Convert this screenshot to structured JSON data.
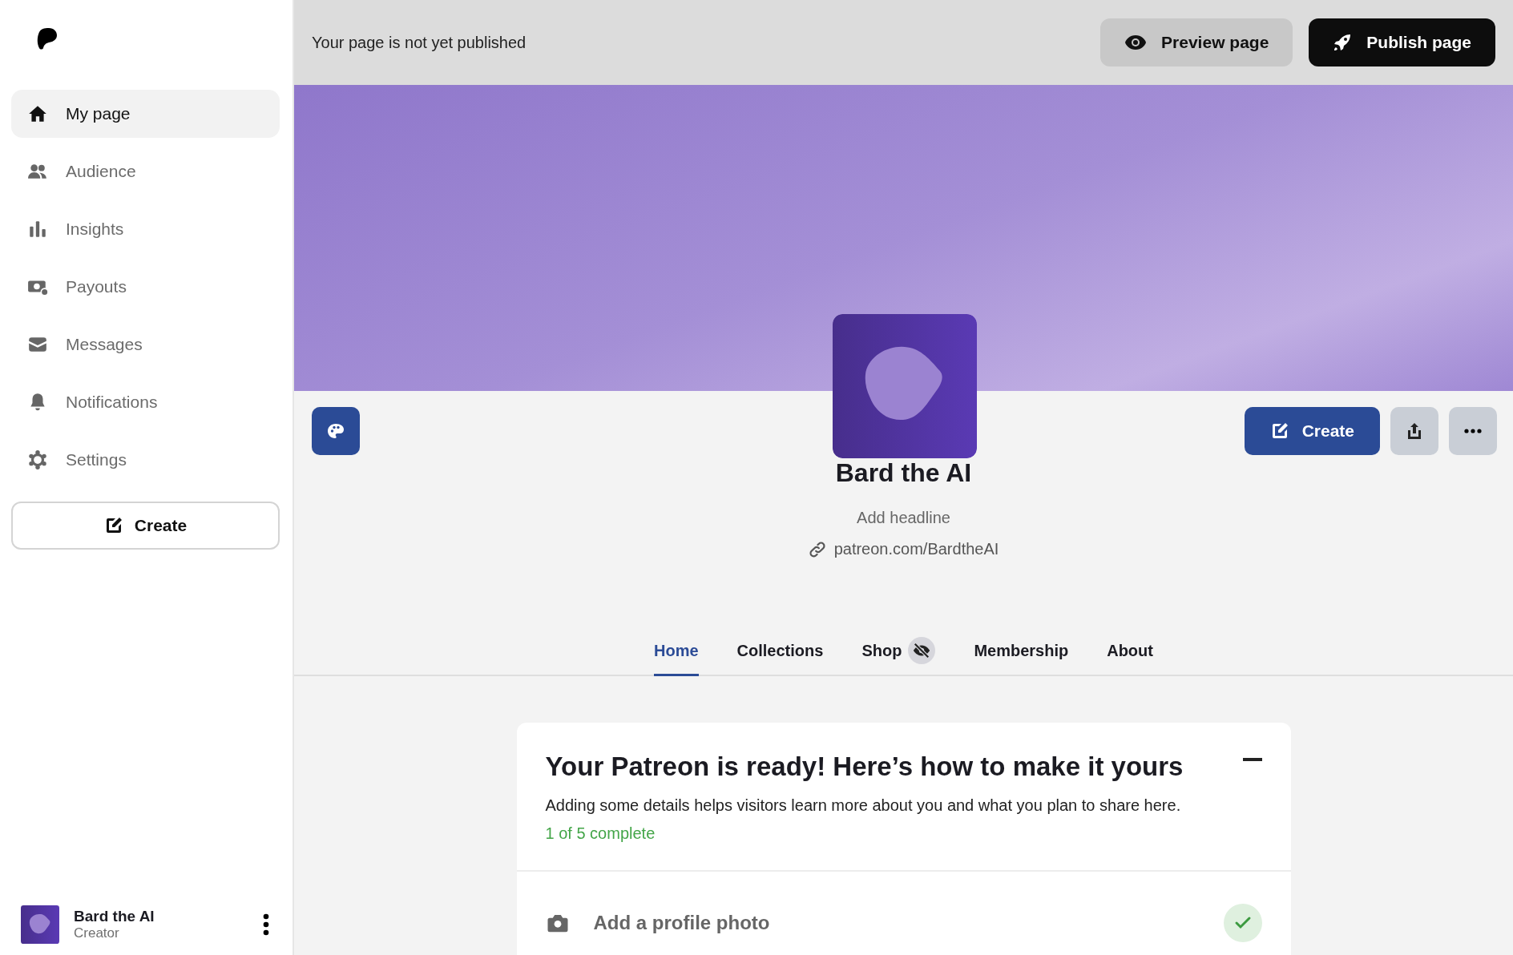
{
  "sidebar": {
    "items": [
      {
        "label": "My page",
        "selected": true
      },
      {
        "label": "Audience",
        "selected": false
      },
      {
        "label": "Insights",
        "selected": false
      },
      {
        "label": "Payouts",
        "selected": false
      },
      {
        "label": "Messages",
        "selected": false
      },
      {
        "label": "Notifications",
        "selected": false
      },
      {
        "label": "Settings",
        "selected": false
      }
    ],
    "create_button": "Create",
    "account": {
      "name": "Bard the AI",
      "role": "Creator"
    }
  },
  "top_bar": {
    "status": "Your page is not yet published",
    "buttons": [
      "Preview page",
      "Publish page"
    ]
  },
  "profile": {
    "name": "Bard the AI",
    "headline_placeholder": "Add headline",
    "url": "patreon.com/BardtheAI",
    "create_button": "Create"
  },
  "tabs": [
    {
      "label": "Home",
      "selected": true,
      "hidden": false
    },
    {
      "label": "Collections",
      "selected": false,
      "hidden": false
    },
    {
      "label": "Shop",
      "selected": false,
      "hidden": true
    },
    {
      "label": "Membership",
      "selected": false,
      "hidden": false
    },
    {
      "label": "About",
      "selected": false,
      "hidden": false
    }
  ],
  "setup_card": {
    "title": "Your Patreon is ready! Here’s how to make it yours",
    "description": "Adding some details helps visitors learn more about you and what you plan to share here.",
    "progress": "1 of 5 complete",
    "steps": [
      {
        "label": "Add a profile photo",
        "done": true
      }
    ]
  }
}
